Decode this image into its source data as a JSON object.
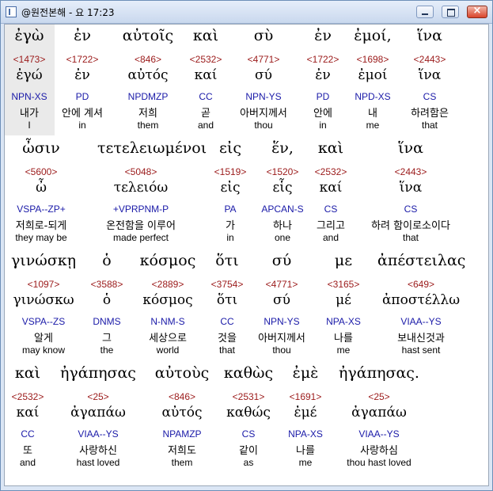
{
  "window": {
    "title": "@원전본해 - 요 17:23",
    "buttons": {
      "minimize": "minimize",
      "maximize": "maximize",
      "close": "×"
    }
  },
  "colors": {
    "strongs": "#9b1a1a",
    "parsing": "#1a1aa8",
    "highlight": "#eaeaea"
  },
  "rows": [
    [
      {
        "greek": "ἐγὼ",
        "strongs": "<1473>",
        "lemma": "ἐγώ",
        "parsing": "NPN-XS",
        "korean": "내가",
        "english": "I"
      },
      {
        "greek": "ἐν",
        "strongs": "<1722>",
        "lemma": "ἐν",
        "parsing": "PD",
        "korean": "안에 계셔",
        "english": "in"
      },
      {
        "greek": "αὐτοῖς",
        "strongs": "<846>",
        "lemma": "αὐτός",
        "parsing": "NPDMZP",
        "korean": "저희",
        "english": "them"
      },
      {
        "greek": "καὶ",
        "strongs": "<2532>",
        "lemma": "καί",
        "parsing": "CC",
        "korean": "곧",
        "english": "and"
      },
      {
        "greek": "σὺ",
        "strongs": "<4771>",
        "lemma": "σύ",
        "parsing": "NPN-YS",
        "korean": "아버지께서",
        "english": "thou"
      },
      {
        "greek": "ἐν",
        "strongs": "<1722>",
        "lemma": "ἐν",
        "parsing": "PD",
        "korean": "안에",
        "english": "in"
      },
      {
        "greek": "ἐμοί,",
        "strongs": "<1698>",
        "lemma": "ἐμοί",
        "parsing": "NPD-XS",
        "korean": "내",
        "english": "me"
      },
      {
        "greek": "ἵνα",
        "strongs": "<2443>",
        "lemma": "ἵνα",
        "parsing": "CS",
        "korean": "하려함은",
        "english": "that"
      }
    ],
    [
      {
        "greek": "ὦσιν",
        "strongs": "<5600>",
        "lemma": "ὦ",
        "parsing": "VSPA--ZP+",
        "korean": "저희로-되게",
        "english": "they may be"
      },
      {
        "greek": "τετελειωμένοι",
        "strongs": "<5048>",
        "lemma": "τελειόω",
        "parsing": "+VPRPNM-P",
        "korean": "온전함을 이루어",
        "english": "made perfect"
      },
      {
        "greek": "εἰς",
        "strongs": "<1519>",
        "lemma": "εἰς",
        "parsing": "PA",
        "korean": "가",
        "english": "in"
      },
      {
        "greek": "ἕν,",
        "strongs": "<1520>",
        "lemma": "εἷς",
        "parsing": "APCAN-S",
        "korean": "하나",
        "english": "one"
      },
      {
        "greek": "καὶ",
        "strongs": "<2532>",
        "lemma": "καί",
        "parsing": "CS",
        "korean": "그리고",
        "english": "and"
      },
      {
        "greek": "ἵνα",
        "strongs": "<2443>",
        "lemma": "ἵνα",
        "parsing": "CS",
        "korean": "하려 함이로소이다",
        "english": "that"
      }
    ],
    [
      {
        "greek": "γινώσκῃ",
        "strongs": "<1097>",
        "lemma": "γινώσκω",
        "parsing": "VSPA--ZS",
        "korean": "알게",
        "english": "may know"
      },
      {
        "greek": "ὁ",
        "strongs": "<3588>",
        "lemma": "ὁ",
        "parsing": "DNMS",
        "korean": "그",
        "english": "the"
      },
      {
        "greek": "κόσμος",
        "strongs": "<2889>",
        "lemma": "κόσμος",
        "parsing": "N-NM-S",
        "korean": "세상으로",
        "english": "world"
      },
      {
        "greek": "ὅτι",
        "strongs": "<3754>",
        "lemma": "ὅτι",
        "parsing": "CC",
        "korean": "것을",
        "english": "that"
      },
      {
        "greek": "σύ",
        "strongs": "<4771>",
        "lemma": "σύ",
        "parsing": "NPN-YS",
        "korean": "아버지께서",
        "english": "thou"
      },
      {
        "greek": "με",
        "strongs": "<3165>",
        "lemma": "μέ",
        "parsing": "NPA-XS",
        "korean": "나를",
        "english": "me"
      },
      {
        "greek": "ἀπέστειλας",
        "strongs": "<649>",
        "lemma": "ἀποστέλλω",
        "parsing": "VIAA--YS",
        "korean": "보내신것과",
        "english": "hast sent"
      }
    ],
    [
      {
        "greek": "καὶ",
        "strongs": "<2532>",
        "lemma": "καί",
        "parsing": "CC",
        "korean": "또",
        "english": "and"
      },
      {
        "greek": "ἠγάπησας",
        "strongs": "<25>",
        "lemma": "ἀγαπάω",
        "parsing": "VIAA--YS",
        "korean": "사랑하신",
        "english": "hast loved"
      },
      {
        "greek": "αὐτοὺς",
        "strongs": "<846>",
        "lemma": "αὐτός",
        "parsing": "NPAMZP",
        "korean": "저희도",
        "english": "them"
      },
      {
        "greek": "καθὼς",
        "strongs": "<2531>",
        "lemma": "καθώς",
        "parsing": "CS",
        "korean": "같이",
        "english": "as"
      },
      {
        "greek": "ἐμὲ",
        "strongs": "<1691>",
        "lemma": "ἐμέ",
        "parsing": "NPA-XS",
        "korean": "나를",
        "english": "me"
      },
      {
        "greek": "ἠγάπησας.",
        "strongs": "<25>",
        "lemma": "ἀγαπάω",
        "parsing": "VIAA--YS",
        "korean": "사랑하심",
        "english": "thou hast loved"
      }
    ]
  ]
}
